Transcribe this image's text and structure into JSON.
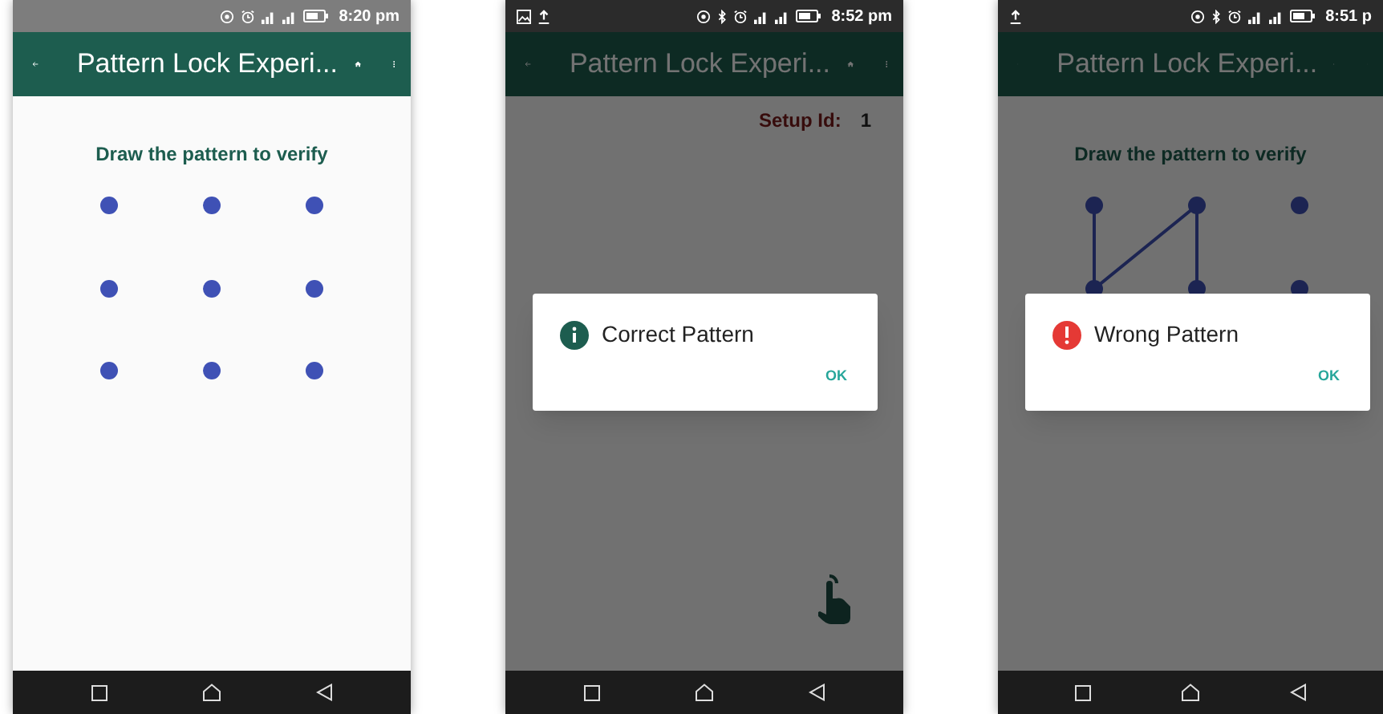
{
  "phones": [
    {
      "dimmed": false,
      "bluetooth": false,
      "notifications": {
        "image": false,
        "upload": false
      },
      "time": "8:20 pm",
      "app_bar": {
        "title": "Pattern Lock Experi..."
      },
      "heading": "Draw the pattern to verify",
      "show_pattern": true
    },
    {
      "dimmed": true,
      "bluetooth": true,
      "notifications": {
        "image": true,
        "upload": true
      },
      "time": "8:52 pm",
      "app_bar": {
        "title": "Pattern Lock Experi..."
      },
      "setup_id": {
        "label": "Setup Id:",
        "value": "1"
      },
      "touch_hint": true,
      "dialog": {
        "kind": "info",
        "title": "Correct Pattern",
        "button": "OK"
      }
    },
    {
      "dimmed": true,
      "bluetooth": true,
      "notifications": {
        "image": false,
        "upload": true
      },
      "time": "8:51 p",
      "app_bar": {
        "title": "Pattern Lock Experi..."
      },
      "heading": "Draw the pattern to verify",
      "show_pattern": true,
      "pattern_path": [
        {
          "kind": "top-left"
        },
        {
          "kind": "middle-left"
        },
        {
          "kind": "top-center"
        },
        {
          "kind": "middle-center"
        }
      ],
      "dialog": {
        "kind": "error",
        "title": "Wrong Pattern",
        "button": "OK"
      }
    }
  ]
}
